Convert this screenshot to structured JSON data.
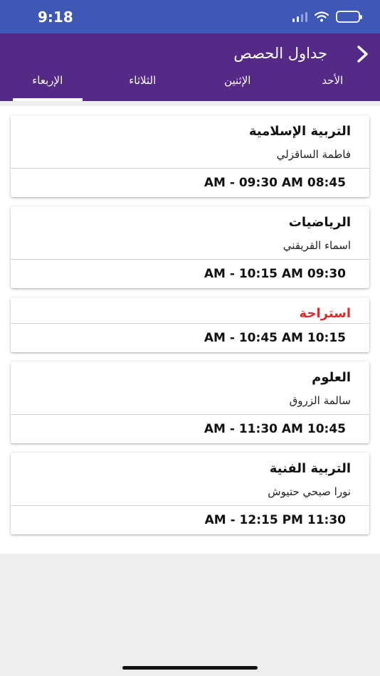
{
  "status_bar": {
    "time": "9:18",
    "icons": [
      "signal-icon",
      "wifi-icon",
      "battery-icon"
    ]
  },
  "header": {
    "title": "جداول الحصص",
    "back_icon": "chevron-right-icon",
    "color": "#552a87"
  },
  "tabs": [
    {
      "label": "الأحد",
      "active": false
    },
    {
      "label": "الإثنين",
      "active": false
    },
    {
      "label": "الثلاثاء",
      "active": false
    },
    {
      "label": "الإربعاء",
      "active": true
    }
  ],
  "periods": [
    {
      "subject": "التربية الإسلامية",
      "teacher": "فاطمة الساقزلي",
      "time": "AM - 09:30 AM 08:45"
    },
    {
      "subject": "الرياضيات",
      "teacher": "اسماء القريقني",
      "time": "AM - 10:15 AM 09:30"
    },
    {
      "subject": "استراحة",
      "time": "AM - 10:45 AM 10:15",
      "is_break": true,
      "color": "#d32f2f"
    },
    {
      "subject": "العلوم",
      "teacher": "سالمة الزروق",
      "time": "AM - 11:30 AM 10:45"
    },
    {
      "subject": "التربية الفنية",
      "teacher": "نورا صبحي حتيوش",
      "time": "AM - 12:15 PM 11:30"
    }
  ]
}
